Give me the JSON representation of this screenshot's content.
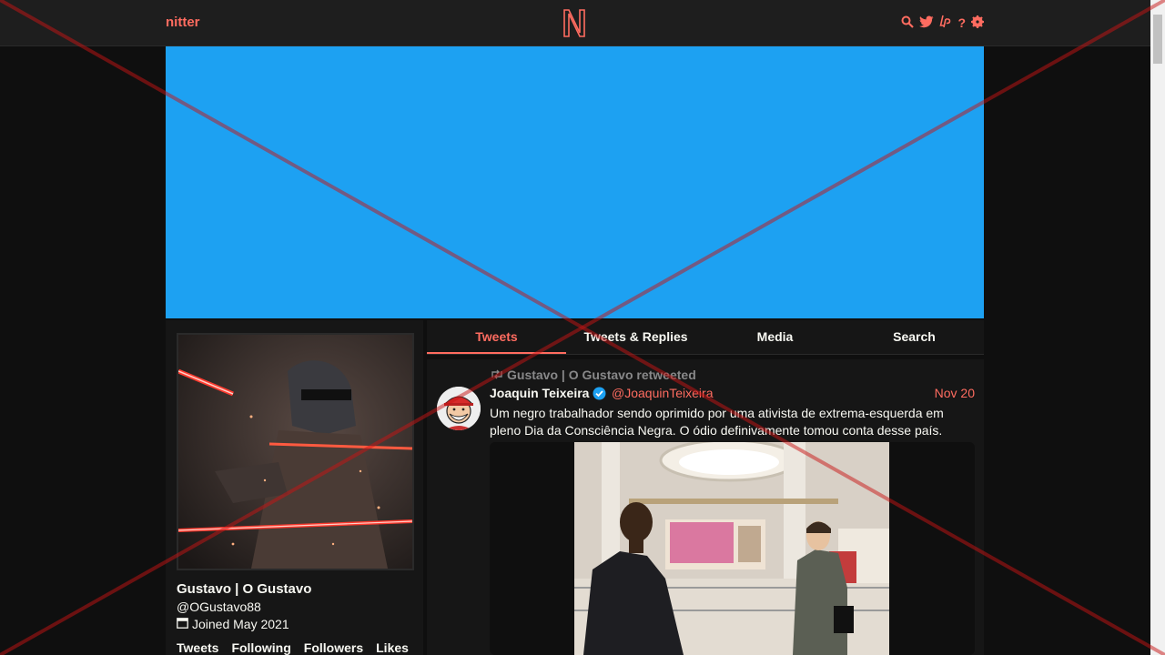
{
  "nav": {
    "brand": "nitter",
    "icons": [
      "search-icon",
      "twitter-icon",
      "liberapay-icon",
      "help-icon",
      "gear-icon"
    ],
    "help_glyph": "?"
  },
  "colors": {
    "accent": "#ff6c60",
    "banner": "#1da1f2",
    "background": "#0f0f0f",
    "panel": "#161616",
    "muted": "#888889"
  },
  "profile": {
    "fullname": "Gustavo | O Gustavo",
    "username": "@OGustavo88",
    "joined": "Joined May 2021",
    "stats": [
      "Tweets",
      "Following",
      "Followers",
      "Likes"
    ]
  },
  "tabs": [
    "Tweets",
    "Tweets & Replies",
    "Media",
    "Search"
  ],
  "tweet": {
    "retweet_label": "Gustavo | O Gustavo retweeted",
    "name": "Joaquin Teixeira",
    "handle": "@JoaquinTeixeira",
    "date": "Nov 20",
    "text": "Um negro trabalhador sendo oprimido por uma ativista de extrema-esquerda em pleno Dia da Consciência Negra. O ódio definivamente tomou conta desse país."
  }
}
